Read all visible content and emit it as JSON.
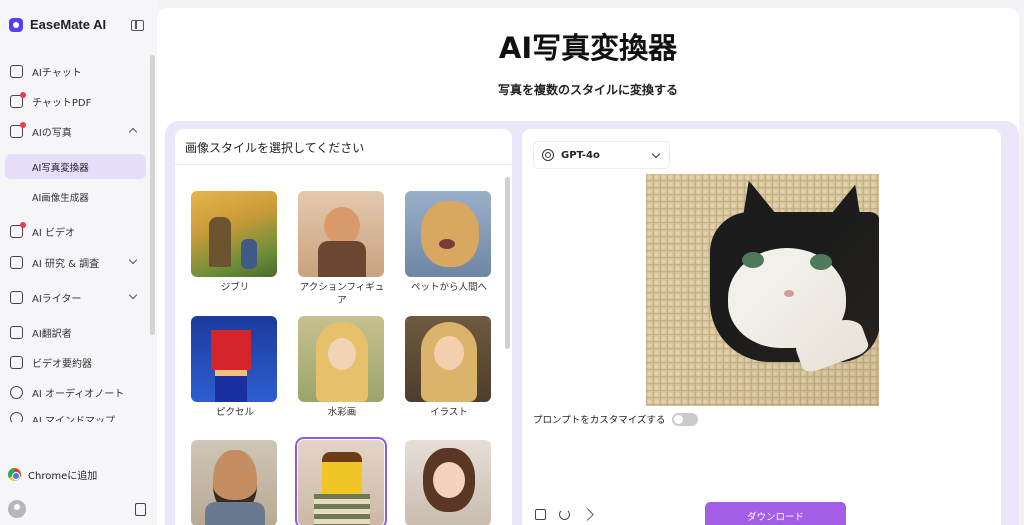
{
  "brand": {
    "name": "EaseMate AI",
    "accent": "#5b3df0"
  },
  "sidebar": {
    "items": [
      {
        "label": "AIチャット",
        "icon": "chat-icon"
      },
      {
        "label": "チャットPDF",
        "icon": "pdf-icon"
      },
      {
        "label": "AIの写真",
        "icon": "photo-icon",
        "expanded": true
      },
      {
        "label": "AI ビデオ",
        "icon": "video-icon"
      },
      {
        "label": "AI 研究 & 調査",
        "icon": "research-icon"
      },
      {
        "label": "AIライター",
        "icon": "pen-icon"
      },
      {
        "label": "AI翻訳者",
        "icon": "translate-icon"
      },
      {
        "label": "ビデオ要約器",
        "icon": "play-icon"
      },
      {
        "label": "AI オーディオノート",
        "icon": "audio-icon"
      },
      {
        "label": "AI マインドマップ",
        "icon": "mindmap-icon"
      }
    ],
    "sub_items": [
      {
        "label": "AI写真変換器",
        "active": true
      },
      {
        "label": "AI画像生成器",
        "active": false
      }
    ],
    "chrome_label": "Chromeに追加"
  },
  "main": {
    "title": "AI写真変換器",
    "subtitle": "写真を複数のスタイルに変換する"
  },
  "style_panel": {
    "title": "画像スタイルを選択してください",
    "styles": [
      {
        "label": "ジブリ",
        "selected": false
      },
      {
        "label": "アクションフィギュア",
        "selected": false
      },
      {
        "label": "ペットから人間へ",
        "selected": false
      },
      {
        "label": "ピクセル",
        "selected": false
      },
      {
        "label": "水彩画",
        "selected": false
      },
      {
        "label": "イラスト",
        "selected": false
      },
      {
        "label": "",
        "selected": false
      },
      {
        "label": "",
        "selected": true
      },
      {
        "label": "",
        "selected": false
      }
    ],
    "selected_color": "#8e58e8"
  },
  "result_panel": {
    "model": "GPT-4o",
    "prompt_label": "プロンプトをカスタマイズする",
    "prompt_enabled": false,
    "download_label": "ダウンロード",
    "download_color": "#a25ee6"
  }
}
